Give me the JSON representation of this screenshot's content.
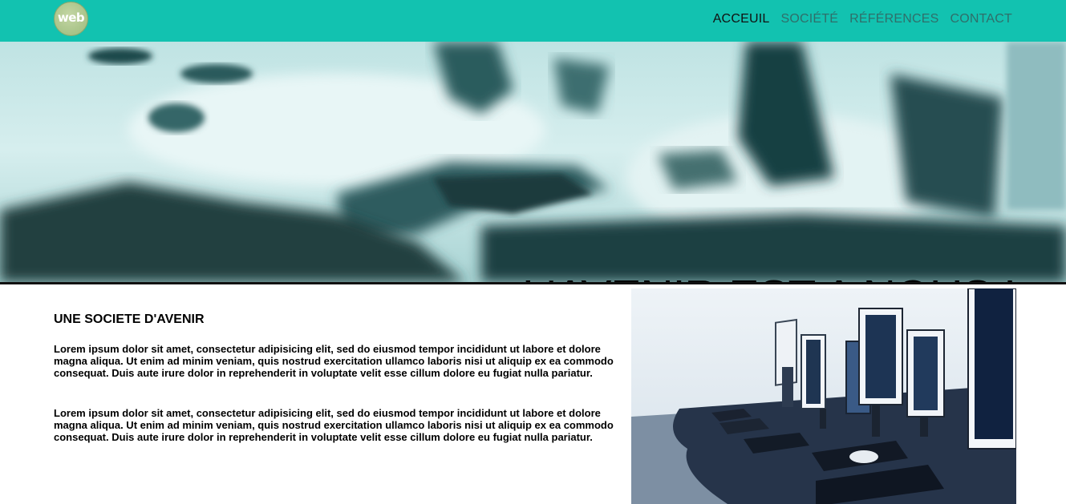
{
  "header": {
    "logo_text": "web",
    "nav": [
      {
        "label": "ACCEUIL",
        "active": true
      },
      {
        "label": "SOCIÉTÉ",
        "active": false
      },
      {
        "label": "RÉFÉRENCES",
        "active": false
      },
      {
        "label": "CONTACT",
        "active": false
      }
    ]
  },
  "hero": {
    "title": "L'AVENIR EST A NOUS !"
  },
  "main": {
    "section_title": "UNE SOCIETE D'AVENIR",
    "paragraphs": [
      "Lorem ipsum dolor sit amet, consectetur adipisicing elit, sed do eiusmod tempor incididunt ut labore et dolore magna aliqua. Ut enim ad minim veniam, quis nostrud exercitation ullamco laboris nisi ut aliquip ex ea commodo consequat. Duis aute irure dolor in reprehenderit in voluptate velit esse cillum dolore eu fugiat nulla pariatur.",
      "Lorem ipsum dolor sit amet, consectetur adipisicing elit, sed do eiusmod tempor incididunt ut labore et dolore magna aliqua. Ut enim ad minim veniam, quis nostrud exercitation ullamco laboris nisi ut aliquip ex ea commodo consequat. Duis aute irure dolor in reprehenderit in voluptate velit esse cillum dolore eu fugiat nulla pariatur."
    ]
  },
  "colors": {
    "header_bg": "#12c2b0",
    "nav_active": "#111111",
    "nav_inactive": "#2f6f6a"
  }
}
